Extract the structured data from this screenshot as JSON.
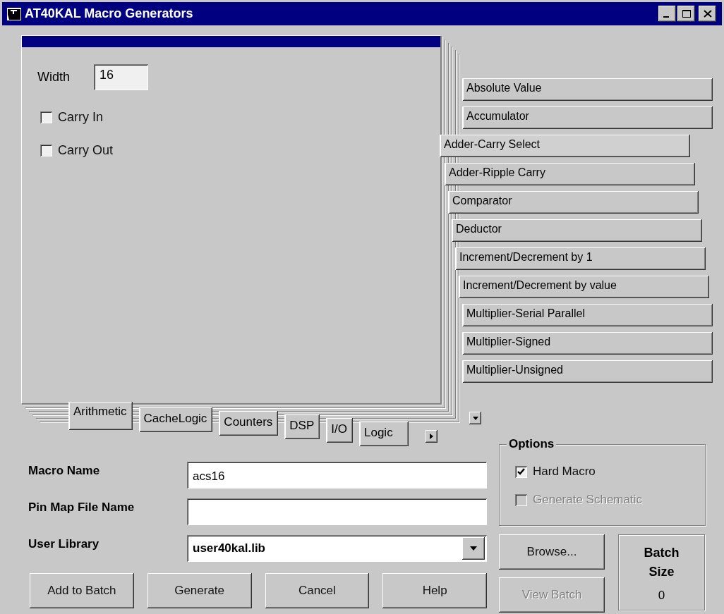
{
  "window": {
    "title": "AT40KAL Macro Generators"
  },
  "panel": {
    "width_label": "Width",
    "width_value": "16",
    "checkboxes": [
      {
        "label": "Carry In",
        "checked": false
      },
      {
        "label": "Carry Out",
        "checked": false
      }
    ]
  },
  "macro_list": [
    {
      "label": "Absolute Value",
      "selected": false
    },
    {
      "label": "Accumulator",
      "selected": false
    },
    {
      "label": "Adder-Carry Select",
      "selected": true
    },
    {
      "label": "Adder-Ripple Carry",
      "selected": false
    },
    {
      "label": "Comparator",
      "selected": false
    },
    {
      "label": "Deductor",
      "selected": false
    },
    {
      "label": "Increment/Decrement by 1",
      "selected": false
    },
    {
      "label": "Increment/Decrement by value",
      "selected": false
    },
    {
      "label": "Multiplier-Serial Parallel",
      "selected": false
    },
    {
      "label": "Multiplier-Signed",
      "selected": false
    },
    {
      "label": "Multiplier-Unsigned",
      "selected": false
    }
  ],
  "category_tabs": [
    {
      "label": "Arithmetic",
      "selected": true
    },
    {
      "label": "CacheLogic",
      "selected": false
    },
    {
      "label": "Counters",
      "selected": false
    },
    {
      "label": "DSP",
      "selected": false
    },
    {
      "label": "I/O",
      "selected": false
    },
    {
      "label": "Logic",
      "selected": false
    }
  ],
  "form": {
    "fields": [
      {
        "label": "Macro Name",
        "kind": "text",
        "value": "acs16"
      },
      {
        "label": "Pin Map File Name",
        "kind": "text"
      },
      {
        "label": "User Library",
        "kind": "dropdown",
        "value": "user40kal.lib"
      }
    ]
  },
  "options": {
    "title": "Options",
    "checkboxes": [
      {
        "label": "Hard Macro",
        "checked": true,
        "disabled": false
      },
      {
        "label": "Generate Schematic",
        "checked": false,
        "disabled": true
      }
    ]
  },
  "side_buttons": [
    {
      "label": "Browse...",
      "disabled": false
    },
    {
      "label": "View Batch",
      "disabled": true
    }
  ],
  "batch": {
    "label": "Batch Size",
    "value": "0"
  },
  "buttons": [
    "Add to Batch",
    "Generate",
    "Cancel",
    "Help"
  ]
}
